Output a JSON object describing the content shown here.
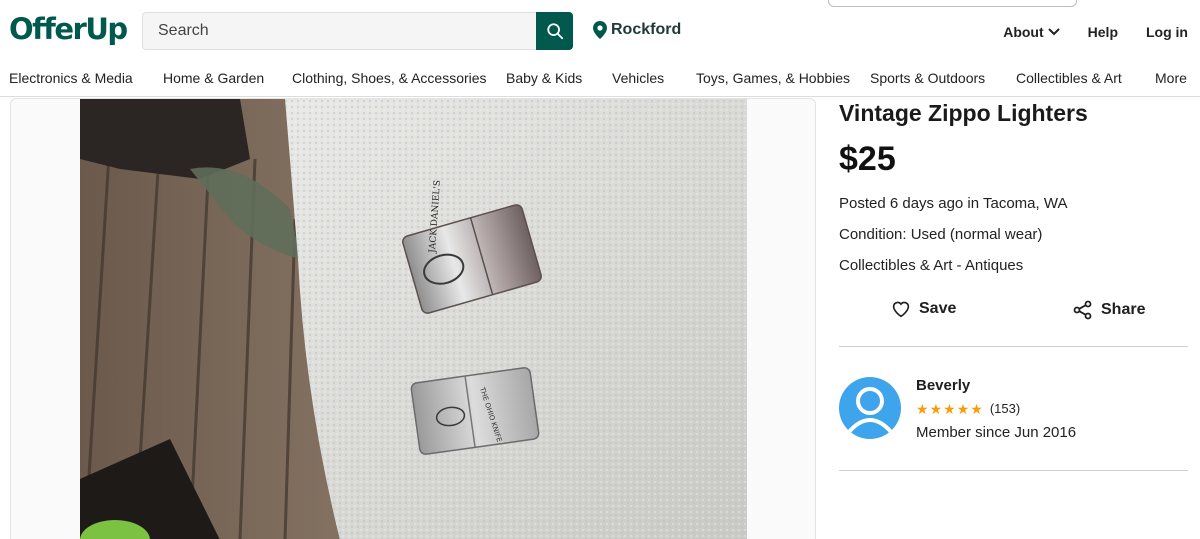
{
  "header": {
    "logo": "OfferUp",
    "search_placeholder": "Search",
    "location": "Rockford",
    "nav": {
      "about": "About",
      "help": "Help",
      "login": "Log in"
    }
  },
  "categories": [
    "Electronics & Media",
    "Home & Garden",
    "Clothing, Shoes, & Accessories",
    "Baby & Kids",
    "Vehicles",
    "Toys, Games, & Hobbies",
    "Sports & Outdoors",
    "Collectibles & Art",
    "More"
  ],
  "photo": {
    "lighter_top_text": "JACK DANIEL'S",
    "lighter_bottom_text": "THE OHIO KNIFE COMPANY"
  },
  "listing": {
    "title": "Vintage Zippo Lighters",
    "price": "$25",
    "posted": "Posted 6 days ago in Tacoma, WA",
    "condition": "Condition: Used (normal wear)",
    "category": "Collectibles & Art - Antiques",
    "save_label": "Save",
    "share_label": "Share"
  },
  "seller": {
    "name": "Beverly",
    "rating_stars": 5,
    "rating_count": "(153)",
    "member_since": "Member since Jun 2016"
  },
  "colors": {
    "brand": "#00594c",
    "star": "#f59e0b",
    "avatar": "#3ea4ec"
  }
}
